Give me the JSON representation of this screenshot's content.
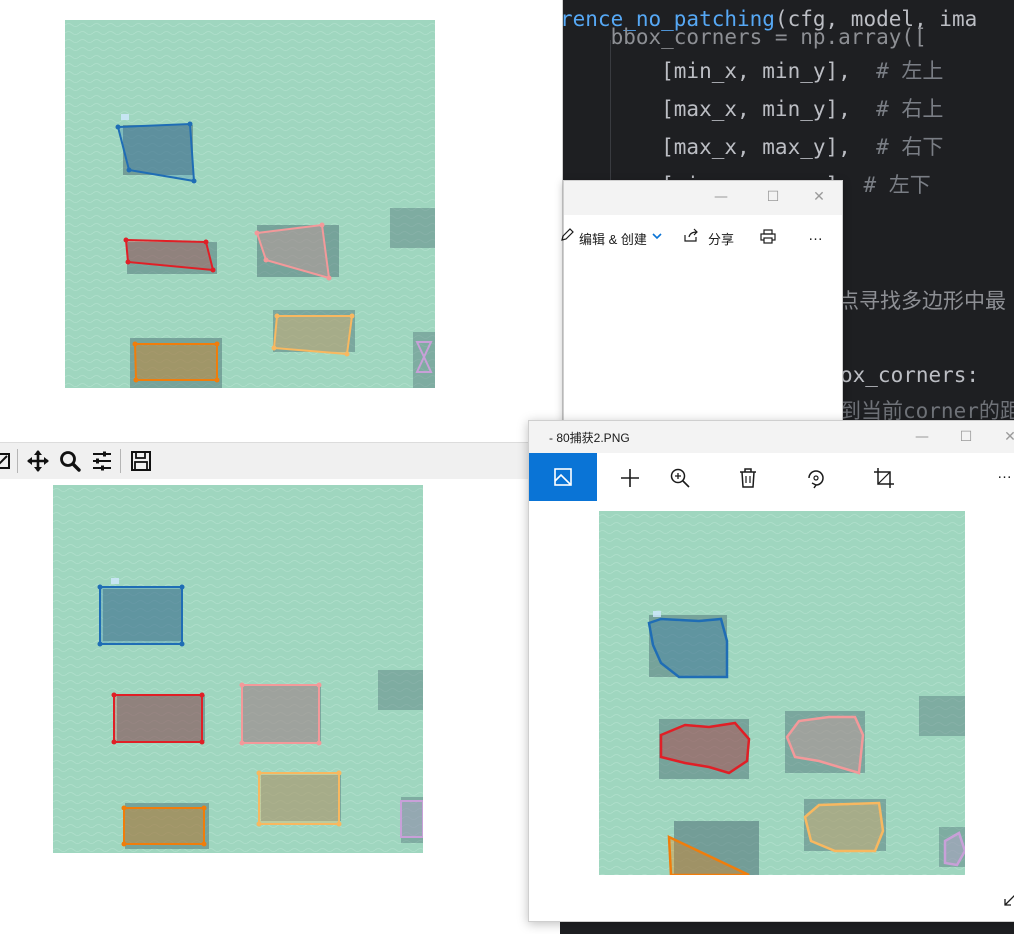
{
  "code_editor": {
    "lines": [
      {
        "pre": "",
        "fn": "rence_no_patching",
        "rest": "(cfg, model, ima",
        "comment": ""
      },
      {
        "pre": "    bbox_corners = np.array([",
        "fn": "",
        "rest": "",
        "comment": ""
      },
      {
        "pre": "        [min_x, min_y],  ",
        "fn": "",
        "rest": "",
        "comment": "# 左上"
      },
      {
        "pre": "        [max_x, min_y],  ",
        "fn": "",
        "rest": "",
        "comment": "# 右上"
      },
      {
        "pre": "        [max_x, max_y],  ",
        "fn": "",
        "rest": "",
        "comment": "# 右下"
      },
      {
        "pre": "        [min_x, max_y]  ",
        "fn": "",
        "rest": "",
        "comment": "# 左下"
      },
      {
        "pre": "点寻找多边形中最",
        "fn": "",
        "rest": "",
        "comment": ""
      },
      {
        "pre": "ox_corners:",
        "fn": "",
        "rest": "",
        "comment": ""
      },
      {
        "pre": "到当前corner的距",
        "fn": "",
        "rest": "",
        "comment": ""
      }
    ]
  },
  "matplotlib_toolbar": {
    "icons": [
      "configure-subplots-partial-icon",
      "pan-icon",
      "zoom-icon",
      "subplots-icon",
      "save-icon"
    ]
  },
  "photos_small": {
    "edit_create_label": "编辑 & 创建",
    "share_label": "分享",
    "more_label": "…",
    "min_label": "—",
    "max_label": "☐",
    "close_label": "✕"
  },
  "photos_large": {
    "title": "- 80捕获2.PNG",
    "min_label": "—",
    "max_label": "☐",
    "close_label": "✕",
    "more_label": "…"
  },
  "colors": {
    "water": "#9fd6bf",
    "blue": "#1f6db5",
    "red": "#e01f26",
    "pink": "#f3999a",
    "orange": "#f07d0b",
    "light_orange": "#f8b860",
    "lavender": "#c8a0d8",
    "accent": "#0a74d6"
  }
}
